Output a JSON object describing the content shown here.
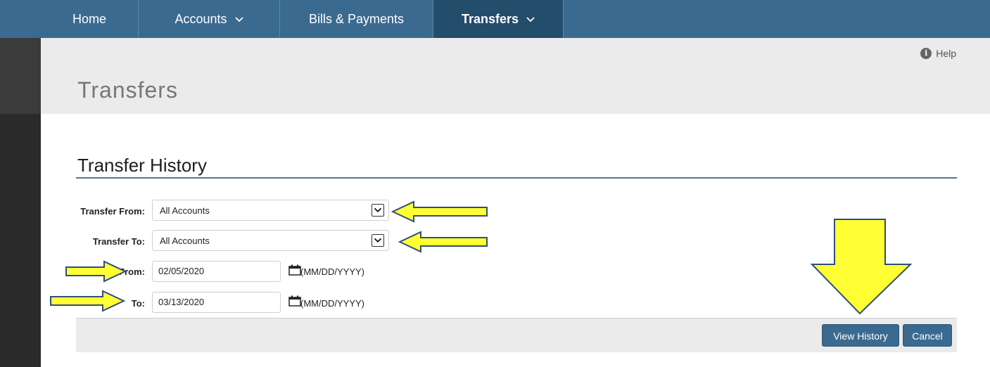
{
  "nav": {
    "items": [
      {
        "label": "Home",
        "has_dropdown": false,
        "active": false
      },
      {
        "label": "Accounts",
        "has_dropdown": true,
        "active": false
      },
      {
        "label": "Bills & Payments",
        "has_dropdown": false,
        "active": false
      },
      {
        "label": "Transfers",
        "has_dropdown": true,
        "active": true
      }
    ]
  },
  "header": {
    "help_label": "Help",
    "page_title": "Transfers"
  },
  "form": {
    "section_title": "Transfer History",
    "transfer_from": {
      "label": "Transfer From:",
      "value": "All Accounts"
    },
    "transfer_to": {
      "label": "Transfer To:",
      "value": "All Accounts"
    },
    "date_from": {
      "label": "From:",
      "value": "02/05/2020",
      "format_hint": "(MM/DD/YYYY)"
    },
    "date_to": {
      "label": "To:",
      "value": "03/13/2020",
      "format_hint": "(MM/DD/YYYY)"
    }
  },
  "actions": {
    "view_history_label": "View History",
    "cancel_label": "Cancel"
  },
  "colors": {
    "nav_bg": "#3a6a90",
    "nav_active_bg": "#244c6b",
    "annotation_arrow_fill": "#ffff33",
    "annotation_arrow_stroke": "#2f4f7a"
  },
  "icons": {
    "nav_dropdown": "chevron-down-icon",
    "help": "info-icon",
    "select": "select-arrow-icon",
    "date": "calendar-icon",
    "annotation": "yellow-arrow-icon"
  }
}
